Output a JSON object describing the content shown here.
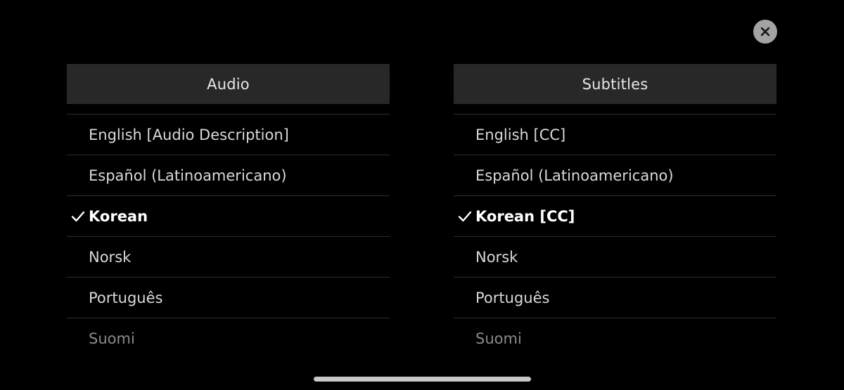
{
  "close_button": {
    "icon": "close-icon"
  },
  "audio": {
    "title": "Audio",
    "items": [
      {
        "label": "English [Audio Description]",
        "selected": false
      },
      {
        "label": "Español (Latinoamericano)",
        "selected": false
      },
      {
        "label": "Korean",
        "selected": true
      },
      {
        "label": "Norsk",
        "selected": false
      },
      {
        "label": "Português",
        "selected": false
      },
      {
        "label": "Suomi",
        "selected": false
      }
    ]
  },
  "subtitles": {
    "title": "Subtitles",
    "items": [
      {
        "label": "English [CC]",
        "selected": false
      },
      {
        "label": "Español (Latinoamericano)",
        "selected": false
      },
      {
        "label": "Korean [CC]",
        "selected": true
      },
      {
        "label": "Norsk",
        "selected": false
      },
      {
        "label": "Português",
        "selected": false
      },
      {
        "label": "Suomi",
        "selected": false
      }
    ]
  },
  "colors": {
    "background": "#000000",
    "header_background": "#282828",
    "close_button": "#a3a3a3",
    "divider": "#2c2c2c",
    "selected_text": "#ffffff"
  }
}
